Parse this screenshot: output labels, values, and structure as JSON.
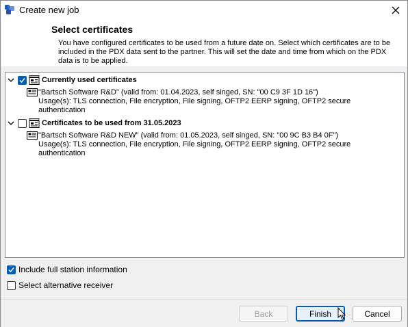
{
  "window": {
    "title": "Create new job"
  },
  "header": {
    "title": "Select certificates",
    "description": "You have configured certificates to be used from a future date on. Select which certificates are to be included in the PDX data sent to the partner. This will set the date and time from which on the PDX data is to be applied."
  },
  "tree": {
    "groups": [
      {
        "label": "Currently used certificates",
        "checked": true,
        "cert_line": "\"Bartsch Software R&D\" (valid from: 01.04.2023, self singed, SN: \"00 C9 3F 1D 16\")",
        "usage_line1": "Usage(s): TLS connection, File encryption, File signing, OFTP2 EERP signing, OFTP2 secure",
        "usage_line2": "authentication"
      },
      {
        "label": "Certificates to be used from 31.05.2023",
        "checked": false,
        "cert_line": "\"Bartsch Software R&D NEW\" (valid from: 01.05.2023, self singed, SN: \"00 9C B3 B4 0F\")",
        "usage_line1": "Usage(s): TLS connection, File encryption, File signing, OFTP2 EERP signing, OFTP2 secure",
        "usage_line2": "authentication"
      }
    ]
  },
  "options": {
    "include_full_station": {
      "label": "Include full station information",
      "checked": true
    },
    "alternative_receiver": {
      "label": "Select alternative receiver",
      "checked": false
    }
  },
  "buttons": {
    "back": "Back",
    "finish": "Finish",
    "cancel": "Cancel"
  },
  "colors": {
    "accent": "#005fb8",
    "header_bg": "#ffffff",
    "dialog_bg": "#f0f0f0"
  }
}
